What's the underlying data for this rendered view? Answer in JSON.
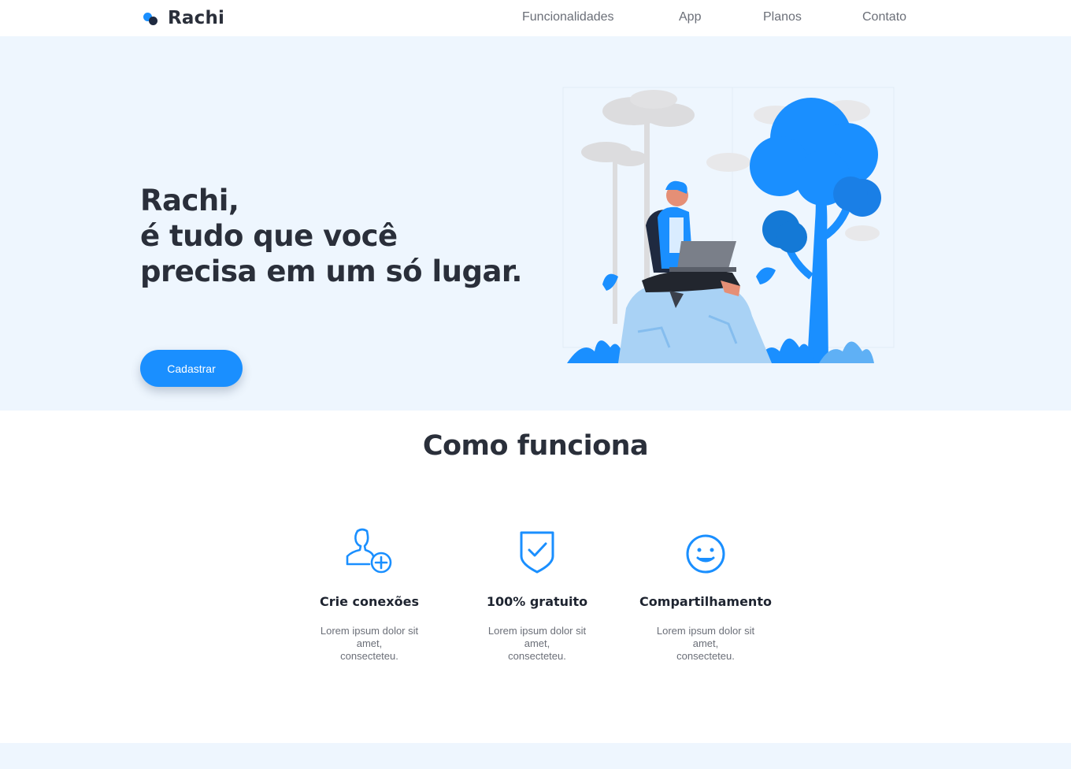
{
  "brand": {
    "name": "Rachi",
    "color_primary": "#1a8fff",
    "color_dark": "#1f2a40"
  },
  "nav": {
    "items": [
      {
        "label": "Funcionalidades"
      },
      {
        "label": "App"
      },
      {
        "label": "Planos"
      },
      {
        "label": "Contato"
      }
    ]
  },
  "hero": {
    "title_lines": [
      "Rachi,",
      "é tudo que você",
      "precisa em um só lugar."
    ],
    "cta_label": "Cadastrar",
    "illustration_icon": "person-with-laptop-on-rock-illustration",
    "background_color": "#eef6fe"
  },
  "how_it_works": {
    "title": "Como funciona",
    "features": [
      {
        "icon": "user-plus-icon",
        "title": "Crie conexões",
        "desc_lines": [
          "Lorem ipsum dolor sit",
          "amet,",
          "consecteteu."
        ]
      },
      {
        "icon": "shield-check-icon",
        "title": "100% gratuito",
        "desc_lines": [
          "Lorem ipsum dolor sit",
          "amet,",
          "consecteteu."
        ]
      },
      {
        "icon": "smiley-icon",
        "title": "Compartilhamento",
        "desc_lines": [
          "Lorem ipsum dolor sit",
          "amet,",
          "consecteteu."
        ]
      }
    ]
  }
}
